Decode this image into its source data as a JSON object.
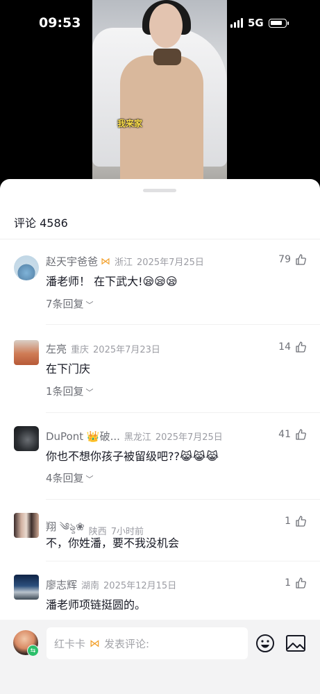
{
  "status": {
    "time": "09:53",
    "network": "5G"
  },
  "video": {
    "subtitle": "我来家"
  },
  "comments_header": {
    "title": "评论 4586"
  },
  "comments": [
    {
      "user": "赵天宇爸爸",
      "badge": "⋈",
      "location": "浙江",
      "date": "2025年7月25日",
      "likes": "79",
      "text": "潘老师！ 在下武大!😪😪😪",
      "replies": "7条回复"
    },
    {
      "user": "左亮",
      "location": "重庆",
      "date": "2025年7月23日",
      "likes": "14",
      "text": "在下门庆",
      "replies": "1条回复"
    },
    {
      "user": "DuPont 👑破...",
      "location": "黑龙江",
      "date": "2025年7月25日",
      "likes": "41",
      "text": "你也不想你孩子被留级吧??😹😹😹",
      "replies": "4条回复"
    },
    {
      "user": "翔 ༄ৡ❀",
      "location": "陕西",
      "date": "7小时前",
      "likes": "1",
      "text": "不，你姓潘，要不我没机会"
    },
    {
      "user": "廖志辉",
      "location": "湖南",
      "date": "2025年12月15日",
      "likes": "1",
      "text": "潘老师项链挺圆的。"
    }
  ],
  "input": {
    "user": "红卡卡",
    "badge": "⋈",
    "placeholder": "发表评论:"
  },
  "colors": {
    "accent": "#f2a02b",
    "sheet": "#ffffff",
    "bar": "#f3f3f4"
  },
  "icons": [
    "signal-icon",
    "battery-icon",
    "like-icon",
    "chevron-down-icon",
    "emoji-icon",
    "image-icon",
    "switch-icon"
  ]
}
